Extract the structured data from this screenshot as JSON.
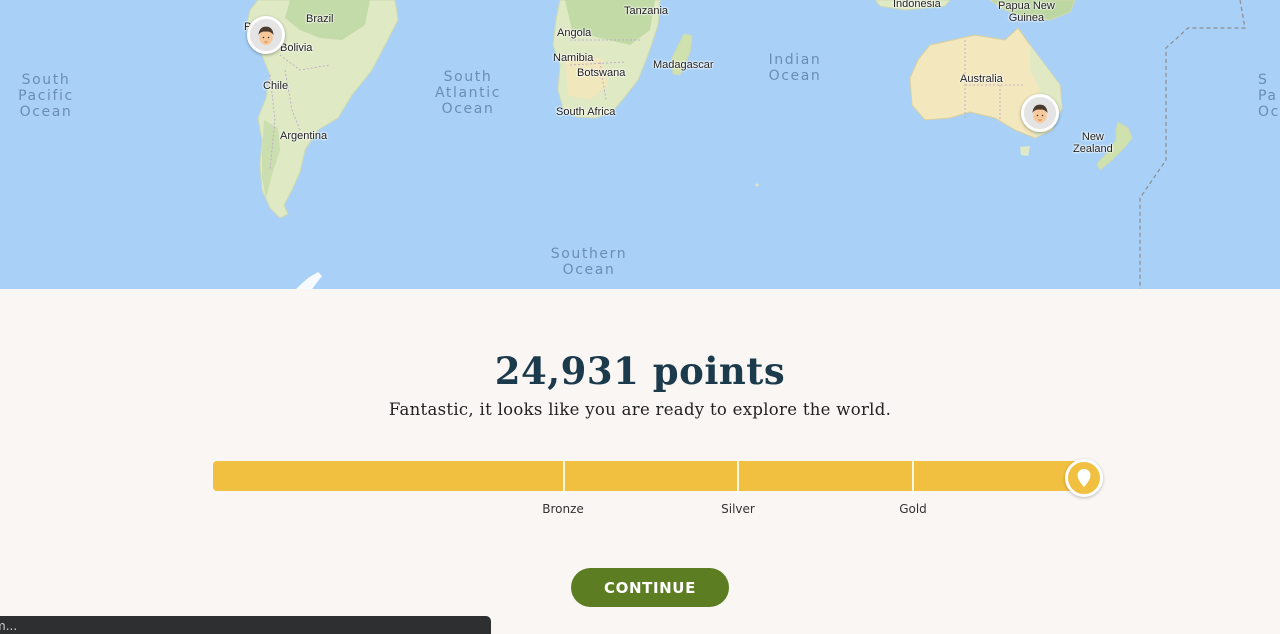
{
  "map": {
    "oceans": [
      {
        "id": "south-pacific",
        "label": "South\nPacific\nOcean"
      },
      {
        "id": "south-atlantic",
        "label": "South\nAtlantic\nOcean"
      },
      {
        "id": "indian",
        "label": "Indian\nOcean"
      },
      {
        "id": "southern",
        "label": "Southern\nOcean"
      },
      {
        "id": "right-edge",
        "label": "S\nPa\nOc"
      }
    ],
    "countries": [
      {
        "id": "brazil",
        "label": "Brazil"
      },
      {
        "id": "bolivia",
        "label": "Bolivia"
      },
      {
        "id": "peru-partial",
        "label": "P"
      },
      {
        "id": "chile",
        "label": "Chile"
      },
      {
        "id": "argentina",
        "label": "Argentina"
      },
      {
        "id": "tanzania",
        "label": "Tanzania"
      },
      {
        "id": "angola",
        "label": "Angola"
      },
      {
        "id": "namibia",
        "label": "Namibia"
      },
      {
        "id": "botswana",
        "label": "Botswana"
      },
      {
        "id": "madagascar",
        "label": "Madagascar"
      },
      {
        "id": "south-africa",
        "label": "South Africa"
      },
      {
        "id": "indonesia",
        "label": "Indonesia"
      },
      {
        "id": "papua-new-guinea",
        "label": "Papua New\nGuinea"
      },
      {
        "id": "australia",
        "label": "Australia"
      },
      {
        "id": "new-zealand",
        "label": "New\nZealand"
      }
    ],
    "colors": {
      "ocean": "#a9d1f7",
      "land": "#e6eccb",
      "land_green": "#bcd7a1",
      "desert": "#f2e7bd"
    }
  },
  "results": {
    "points": "24,931 points",
    "message": "Fantastic, it looks like you are ready to explore the world.",
    "tiers": [
      "Bronze",
      "Silver",
      "Gold"
    ],
    "progress_fraction": 1.0,
    "continue_label": "CONTINUE"
  },
  "toast": {
    "text": "m..."
  },
  "colors": {
    "accent": "#f2c040",
    "button": "#5c7d22",
    "heading": "#1b3a4b",
    "background": "#f9f6f3"
  }
}
